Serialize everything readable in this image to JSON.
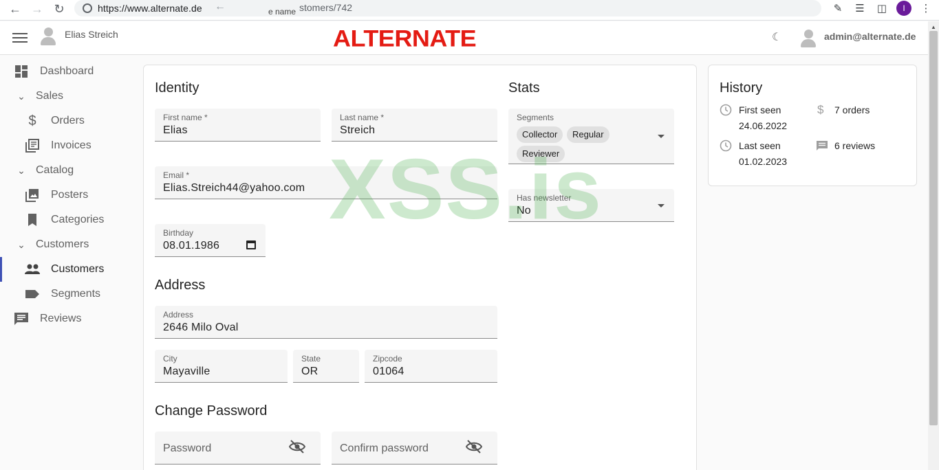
{
  "browser": {
    "url": "https://www.alternate.de",
    "url_tail": "stomers/742",
    "ghost_text": "e name",
    "profile_initial": "I"
  },
  "header": {
    "user_name": "Elias Streich",
    "brand": "ALTERNATE",
    "admin_email": "admin@alternate.de"
  },
  "sidebar": {
    "dashboard": "Dashboard",
    "sales": "Sales",
    "orders": "Orders",
    "invoices": "Invoices",
    "catalog": "Catalog",
    "posters": "Posters",
    "categories": "Categories",
    "customers_group": "Customers",
    "customers": "Customers",
    "segments": "Segments",
    "reviews": "Reviews"
  },
  "identity": {
    "title": "Identity",
    "first_name_label": "First name *",
    "first_name": "Elias",
    "last_name_label": "Last name *",
    "last_name": "Streich",
    "email_label": "Email *",
    "email": "Elias.Streich44@yahoo.com",
    "birthday_label": "Birthday",
    "birthday": "08.01.1986"
  },
  "address": {
    "title": "Address",
    "address_label": "Address",
    "address": "2646 Milo Oval",
    "city_label": "City",
    "city": "Mayaville",
    "state_label": "State",
    "state": "OR",
    "zip_label": "Zipcode",
    "zip": "01064"
  },
  "password": {
    "title": "Change Password",
    "password_placeholder": "Password",
    "confirm_placeholder": "Confirm password"
  },
  "stats": {
    "title": "Stats",
    "segments_label": "Segments",
    "segments": [
      "Collector",
      "Regular",
      "Reviewer"
    ],
    "newsletter_label": "Has newsletter",
    "newsletter": "No"
  },
  "history": {
    "title": "History",
    "first_seen_label": "First seen",
    "first_seen": "24.06.2022",
    "last_seen_label": "Last seen",
    "last_seen": "01.02.2023",
    "orders": "7 orders",
    "reviews": "6 reviews"
  },
  "watermark": "XSS.is",
  "colors": {
    "brand": "#e41b13",
    "active_indicator": "#3f51b5",
    "field_bg": "#f5f5f5"
  }
}
